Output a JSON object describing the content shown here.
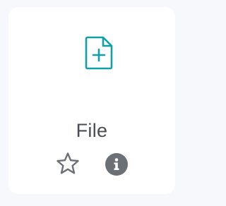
{
  "tile": {
    "label": "File",
    "icon": "file-add-icon",
    "icon_color": "#11a0a5"
  },
  "actions": {
    "favorite_icon": "star-outline-icon",
    "info_icon": "info-icon",
    "icon_color": "#6b7077"
  }
}
